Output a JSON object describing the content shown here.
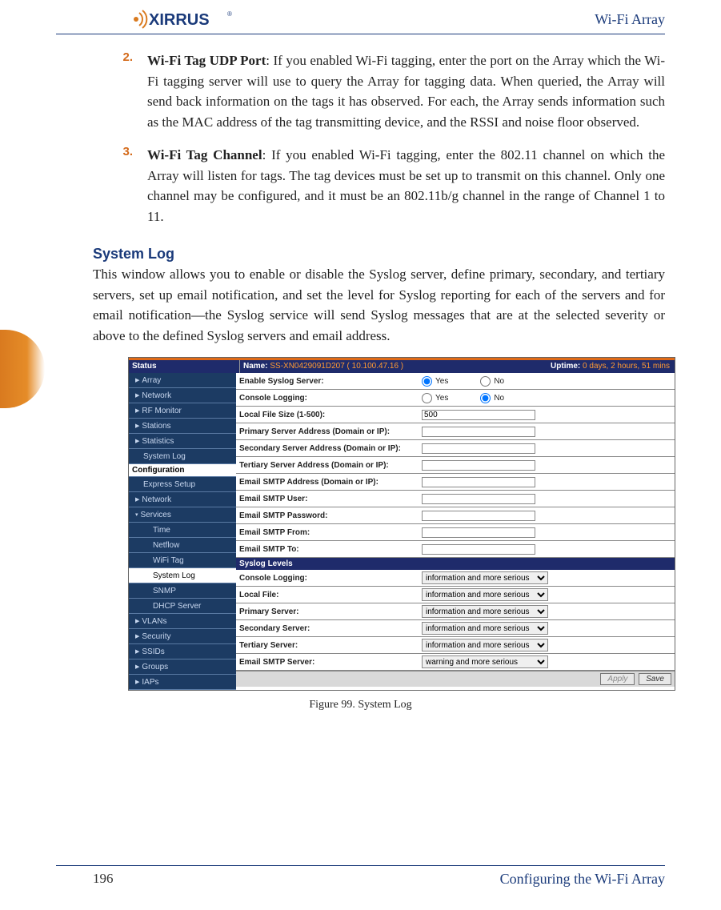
{
  "header": {
    "brand_text": "XIRRUS",
    "right": "Wi-Fi Array"
  },
  "items": {
    "n2": {
      "num": "2.",
      "title": "Wi-Fi Tag UDP Port",
      "text": ": If you enabled Wi-Fi tagging, enter the port on the Array which the Wi-Fi tagging server will use to query the Array for tagging data. When queried, the Array will send back information on the tags it has observed. For each, the Array sends information such as the MAC address of the tag transmitting device, and the RSSI and noise floor observed."
    },
    "n3": {
      "num": "3.",
      "title": "Wi-Fi Tag Channel",
      "text": ": If you enabled Wi-Fi tagging, enter the 802.11 channel on which the Array will listen for tags. The tag devices must be set up to transmit on this channel. Only one channel may be configured, and it must be an 802.11b/g channel in the range of Channel 1 to 11."
    }
  },
  "section": {
    "heading": "System Log",
    "intro": "This window allows you to enable or disable the Syslog server, define primary, secondary, and tertiary servers, set up email notification, and set the level for Syslog reporting for each of the servers and for email notification—the Syslog service will send Syslog messages that are at the selected severity or above to the defined Syslog servers and email address."
  },
  "figure": {
    "status_left": "Status",
    "name_label": "Name:",
    "name_value": "SS-XN0429091D207   ( 10.100.47.16 )",
    "uptime_label": "Uptime:",
    "uptime_value": "0 days, 2 hours, 51 mins",
    "sidebar": {
      "array": "Array",
      "network": "Network",
      "rf": "RF Monitor",
      "stations": "Stations",
      "statistics": "Statistics",
      "syslog": "System Log",
      "configuration": "Configuration",
      "express": "Express Setup",
      "network2": "Network",
      "services": "Services",
      "time": "Time",
      "netflow": "Netflow",
      "wifitag": "WiFi Tag",
      "syslog2": "System Log",
      "snmp": "SNMP",
      "dhcp": "DHCP Server",
      "vlans": "VLANs",
      "security": "Security",
      "ssids": "SSIDs",
      "groups": "Groups",
      "iaps": "IAPs"
    },
    "form": {
      "enable_label": "Enable Syslog Server:",
      "yes": "Yes",
      "no": "No",
      "console_label": "Console Logging:",
      "filesize_label": "Local File Size (1-500):",
      "filesize_value": "500",
      "primary_label": "Primary Server Address (Domain or IP):",
      "secondary_label": "Secondary Server Address (Domain or IP):",
      "tertiary_label": "Tertiary Server Address (Domain or IP):",
      "smtp_addr_label": "Email SMTP Address (Domain or IP):",
      "smtp_user_label": "Email SMTP User:",
      "smtp_pass_label": "Email SMTP Password:",
      "smtp_from_label": "Email SMTP From:",
      "smtp_to_label": "Email SMTP To:",
      "levels_header": "Syslog Levels",
      "lvl_console": "Console Logging:",
      "lvl_local": "Local File:",
      "lvl_primary": "Primary Server:",
      "lvl_secondary": "Secondary Server:",
      "lvl_tertiary": "Tertiary Server:",
      "lvl_email": "Email SMTP Server:",
      "opt_info": "information and more serious",
      "opt_warn": "warning and more serious",
      "apply": "Apply",
      "save": "Save"
    },
    "caption": "Figure 99. System Log"
  },
  "footer": {
    "page": "196",
    "right": "Configuring the Wi-Fi Array"
  }
}
